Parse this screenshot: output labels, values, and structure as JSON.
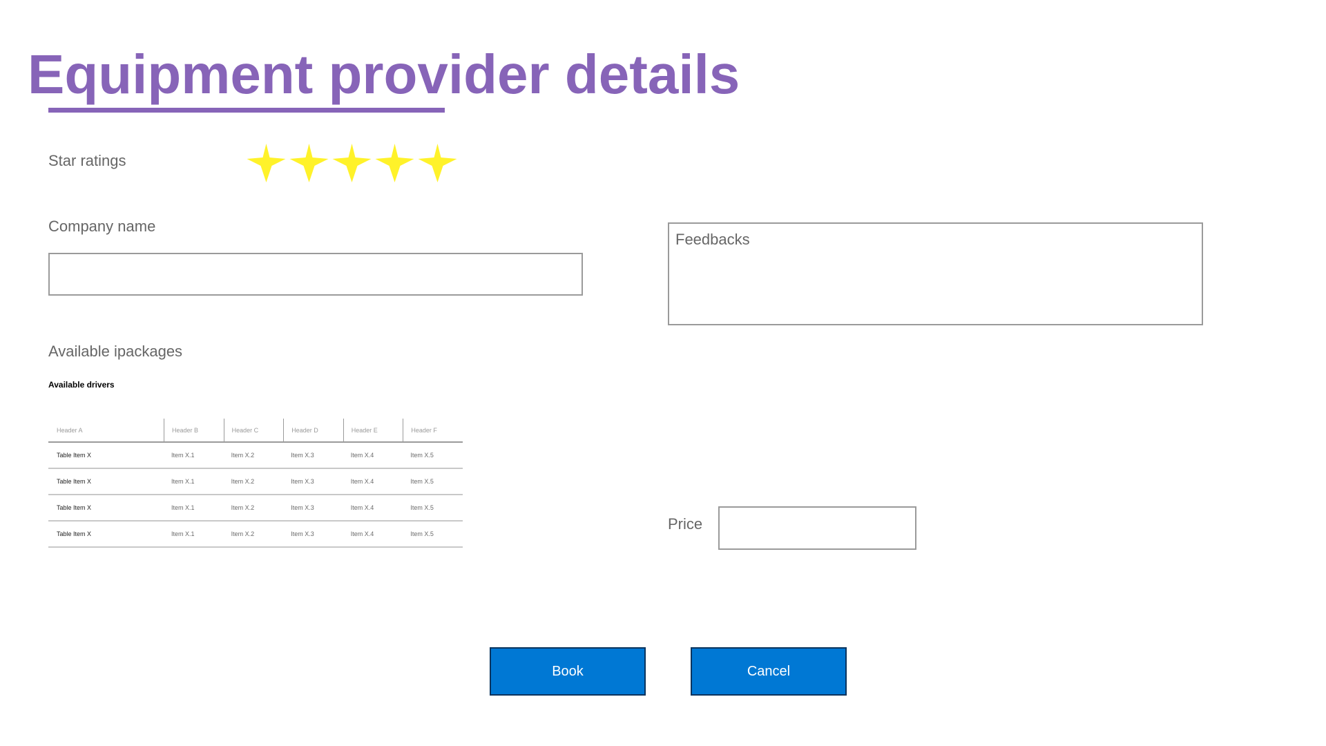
{
  "page": {
    "title": "Equipment provider details"
  },
  "rating": {
    "label": "Star ratings",
    "stars_filled": 5,
    "stars_total": 5,
    "star_color": "#fff22a"
  },
  "company": {
    "label": "Company name",
    "value": "",
    "placeholder": ""
  },
  "feedback": {
    "placeholder": "Feedbacks",
    "value": ""
  },
  "packages": {
    "label": "Available ipackages"
  },
  "drivers": {
    "title": "Available drivers",
    "headers": [
      "Header A",
      "Header B",
      "Header C",
      "Header D",
      "Header E",
      "Header F"
    ],
    "rows": [
      [
        "Table Item X",
        "Item X.1",
        "Item X.2",
        "Item X.3",
        "Item X.4",
        "Item X.5"
      ],
      [
        "Table Item X",
        "Item X.1",
        "Item X.2",
        "Item X.3",
        "Item X.4",
        "Item X.5"
      ],
      [
        "Table Item X",
        "Item X.1",
        "Item X.2",
        "Item X.3",
        "Item X.4",
        "Item X.5"
      ],
      [
        "Table Item X",
        "Item X.1",
        "Item X.2",
        "Item X.3",
        "Item X.4",
        "Item X.5"
      ]
    ]
  },
  "price": {
    "label": "Price",
    "value": ""
  },
  "actions": {
    "book_label": "Book",
    "cancel_label": "Cancel"
  },
  "colors": {
    "title": "#8764b8",
    "button_bg": "#0078d4",
    "button_border": "#07335d",
    "label": "#666666"
  }
}
